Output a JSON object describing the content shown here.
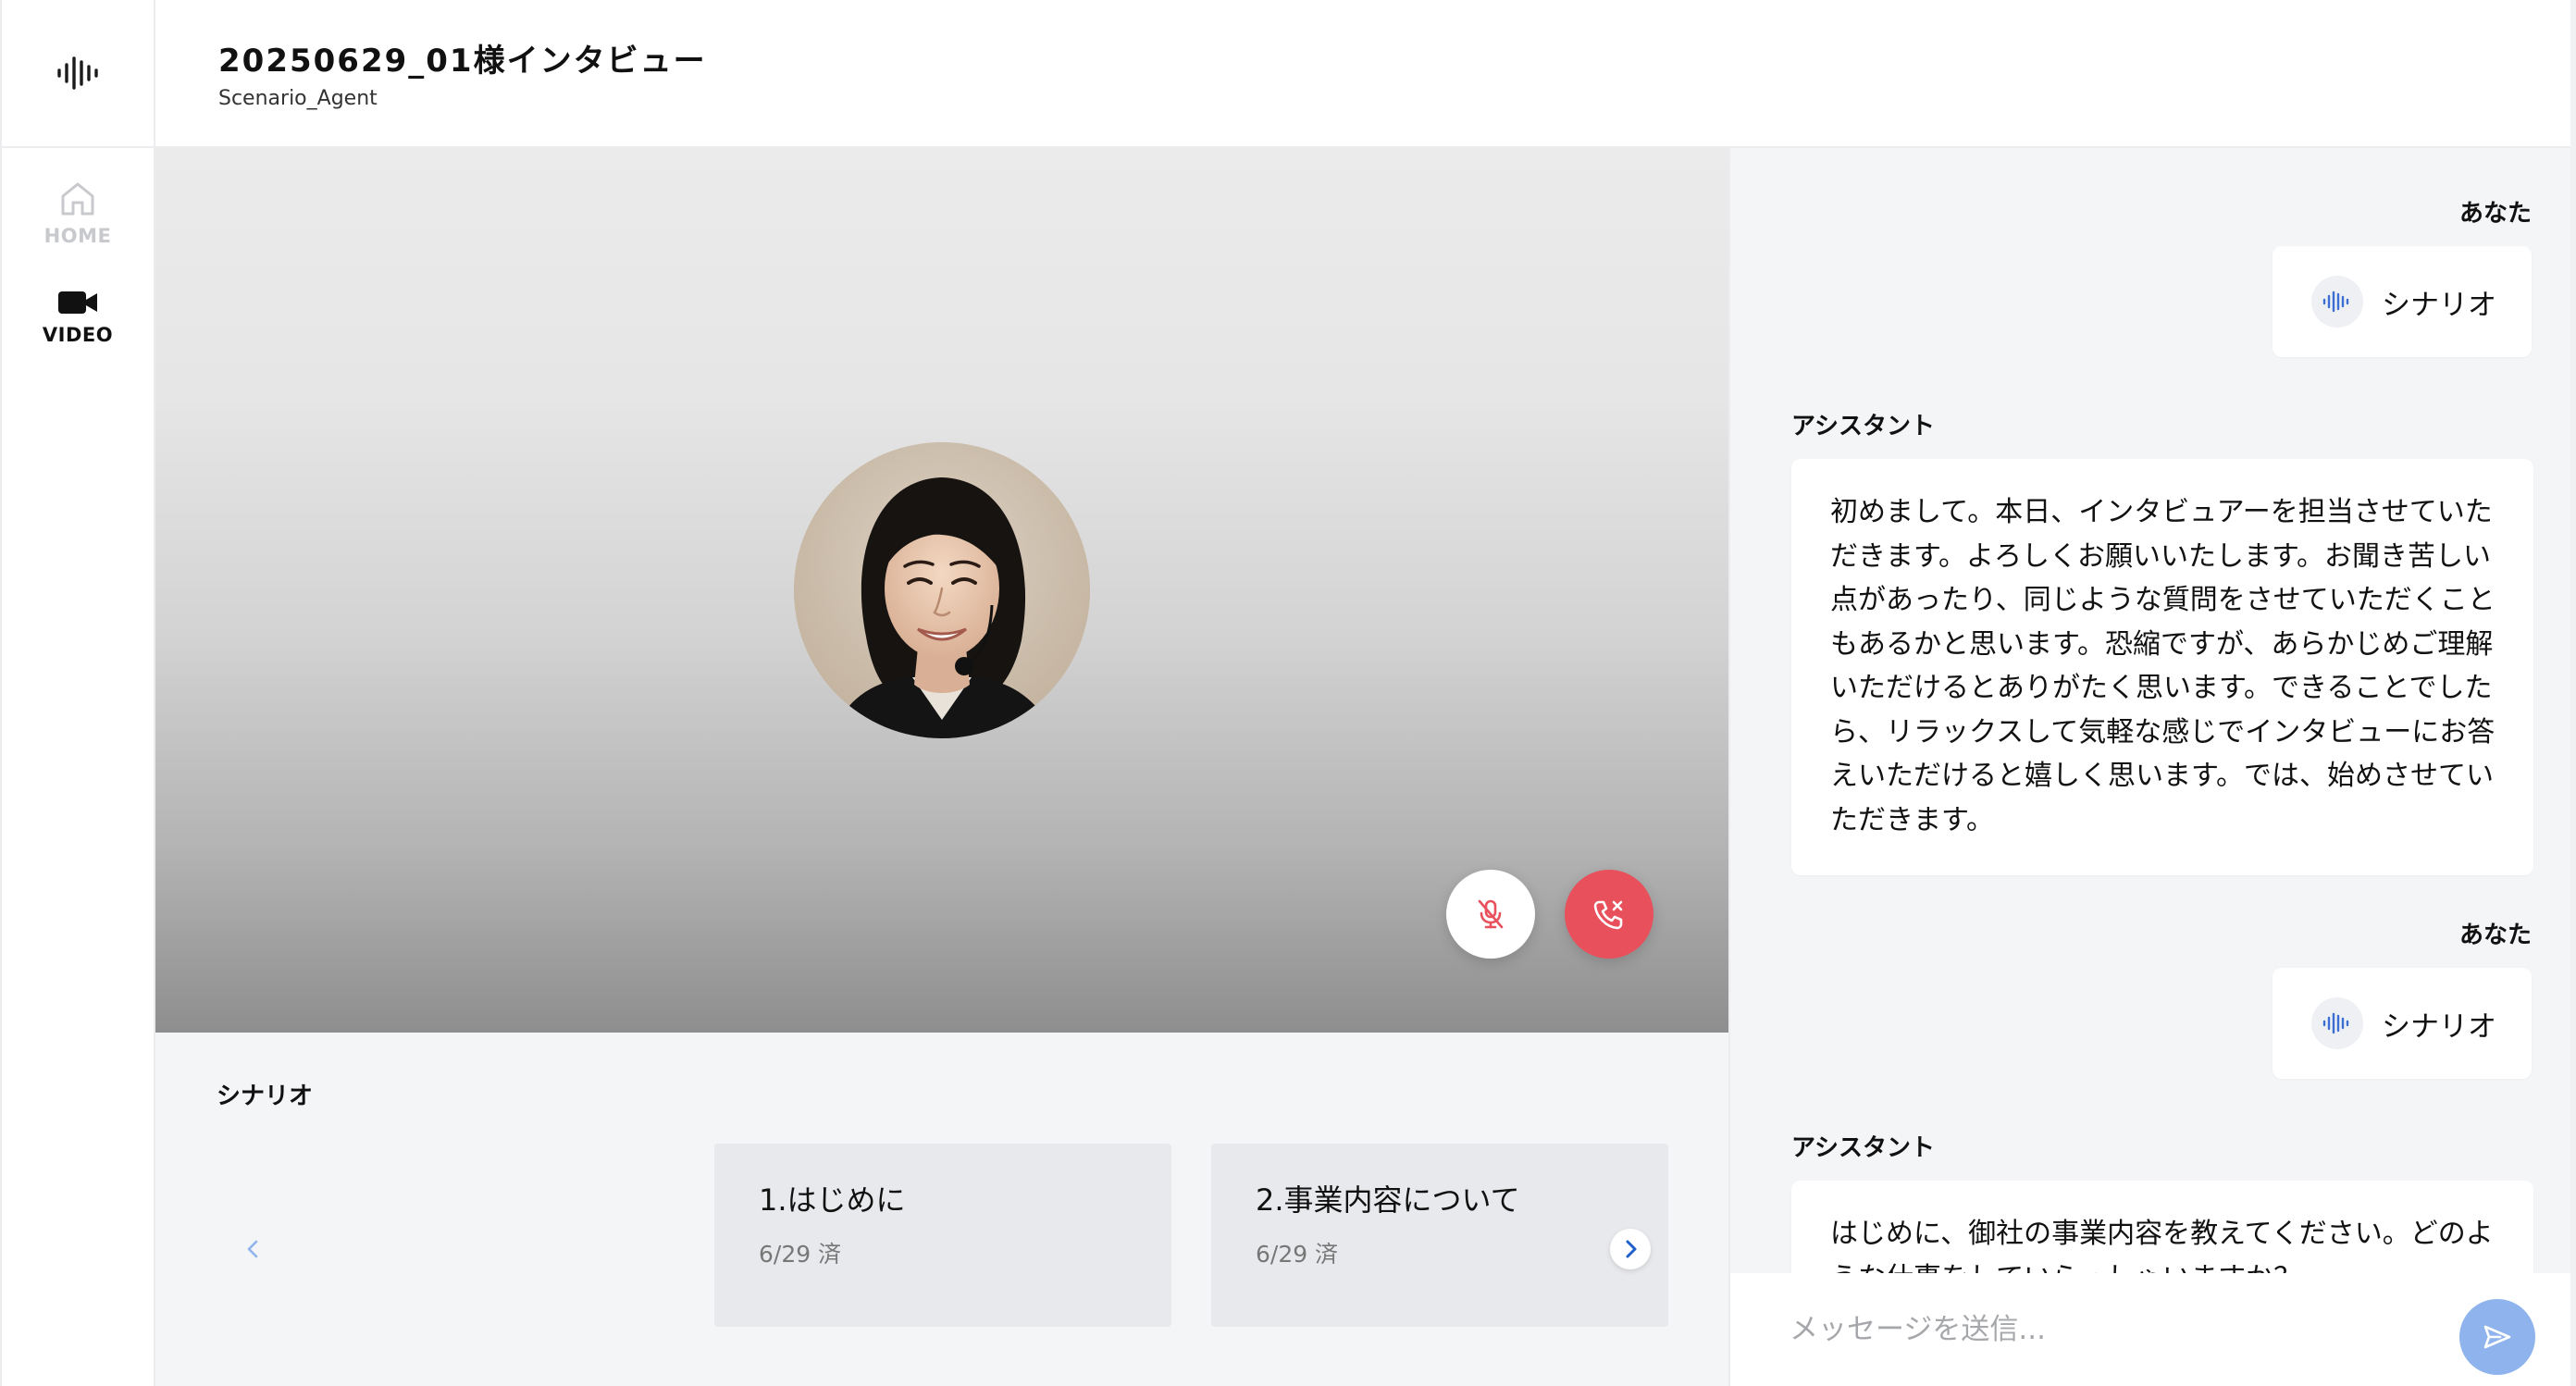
{
  "header": {
    "title": "20250629_01様インタビュー",
    "subtitle": "Scenario_Agent"
  },
  "nav": {
    "logo_icon": "waveform-icon",
    "items": [
      {
        "label": "HOME",
        "icon": "home-icon",
        "active": false
      },
      {
        "label": "VIDEO",
        "icon": "video-camera-icon",
        "active": true
      }
    ]
  },
  "video": {
    "controls": {
      "mute_icon": "mic-off-icon",
      "end_icon": "phone-end-icon"
    },
    "colors": {
      "end_call": "#e8505b"
    }
  },
  "scenario": {
    "title": "シナリオ",
    "cards": [
      {
        "title": "1.はじめに",
        "date": "6/29 済"
      },
      {
        "title": "2.事業内容について",
        "date": "6/29 済"
      }
    ]
  },
  "chat": {
    "messages": [
      {
        "sender": "あなた",
        "text": "シナリオ",
        "icon": "waveform-icon"
      },
      {
        "sender": "アシスタント",
        "text": "初めまして。本日、インタビュアーを担当させていただきます。よろしくお願いいたします。お聞き苦しい点があったり、同じような質問をさせていただくこともあるかと思います。恐縮ですが、あらかじめご理解いただけるとありがたく思います。できることでしたら、リラックスして気軽な感じでインタビューにお答えいただけると嬉しく思います。では、始めさせていただきます。"
      },
      {
        "sender": "あなた",
        "text": "シナリオ",
        "icon": "waveform-icon"
      },
      {
        "sender": "アシスタント",
        "text": "はじめに、御社の事業内容を教えてください。どのような仕事をしていらっしゃいますか？"
      }
    ],
    "input": {
      "placeholder": "メッセージを送信...",
      "value": ""
    },
    "send_icon": "send-icon",
    "colors": {
      "send_button": "#8fb3ec",
      "accent": "#3b6fd4"
    }
  }
}
